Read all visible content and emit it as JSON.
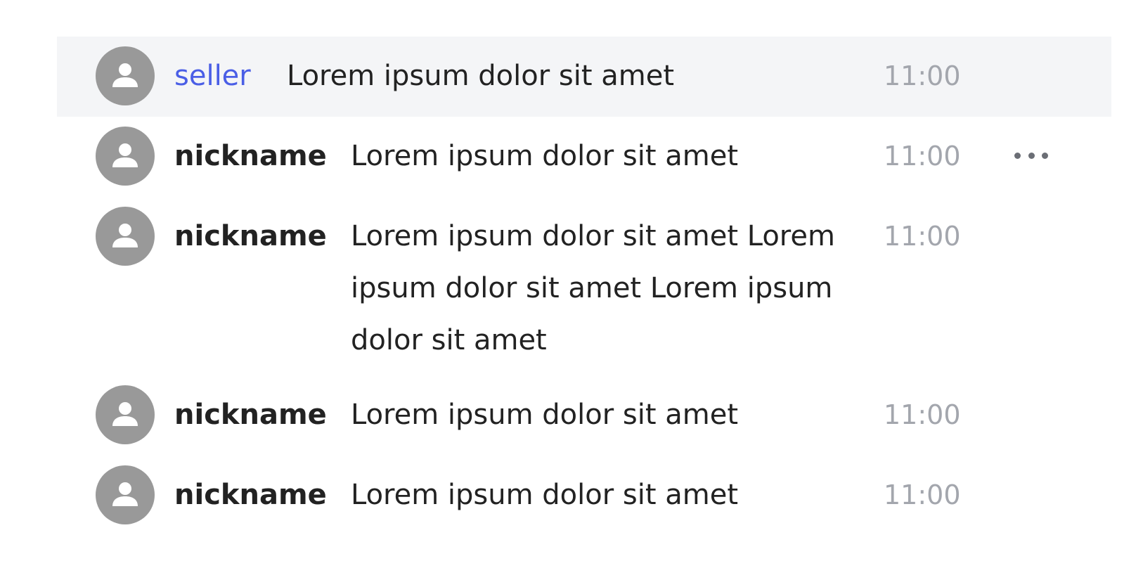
{
  "messages": [
    {
      "nickname": "seller",
      "text": "Lorem ipsum dolor sit amet",
      "time": "11:00",
      "is_seller": true
    },
    {
      "nickname": "nickname",
      "text": "Lorem ipsum dolor sit amet",
      "time": "11:00",
      "has_more_menu": true
    },
    {
      "nickname": "nickname",
      "text": "Lorem ipsum dolor sit amet Lorem ipsum dolor sit amet Lorem ipsum dolor sit amet",
      "time": "11:00"
    },
    {
      "nickname": "nickname",
      "text": "Lorem ipsum dolor sit amet",
      "time": "11:00"
    },
    {
      "nickname": "nickname",
      "text": "Lorem ipsum dolor sit amet",
      "time": "11:00"
    }
  ],
  "icons": {
    "avatar": "user-silhouette-icon",
    "more": "more-horizontal-icon"
  },
  "colors": {
    "seller_name": "#4a5ee6",
    "highlight_background": "#f4f5f7",
    "avatar": "#999999",
    "time": "#a3a6ad"
  }
}
